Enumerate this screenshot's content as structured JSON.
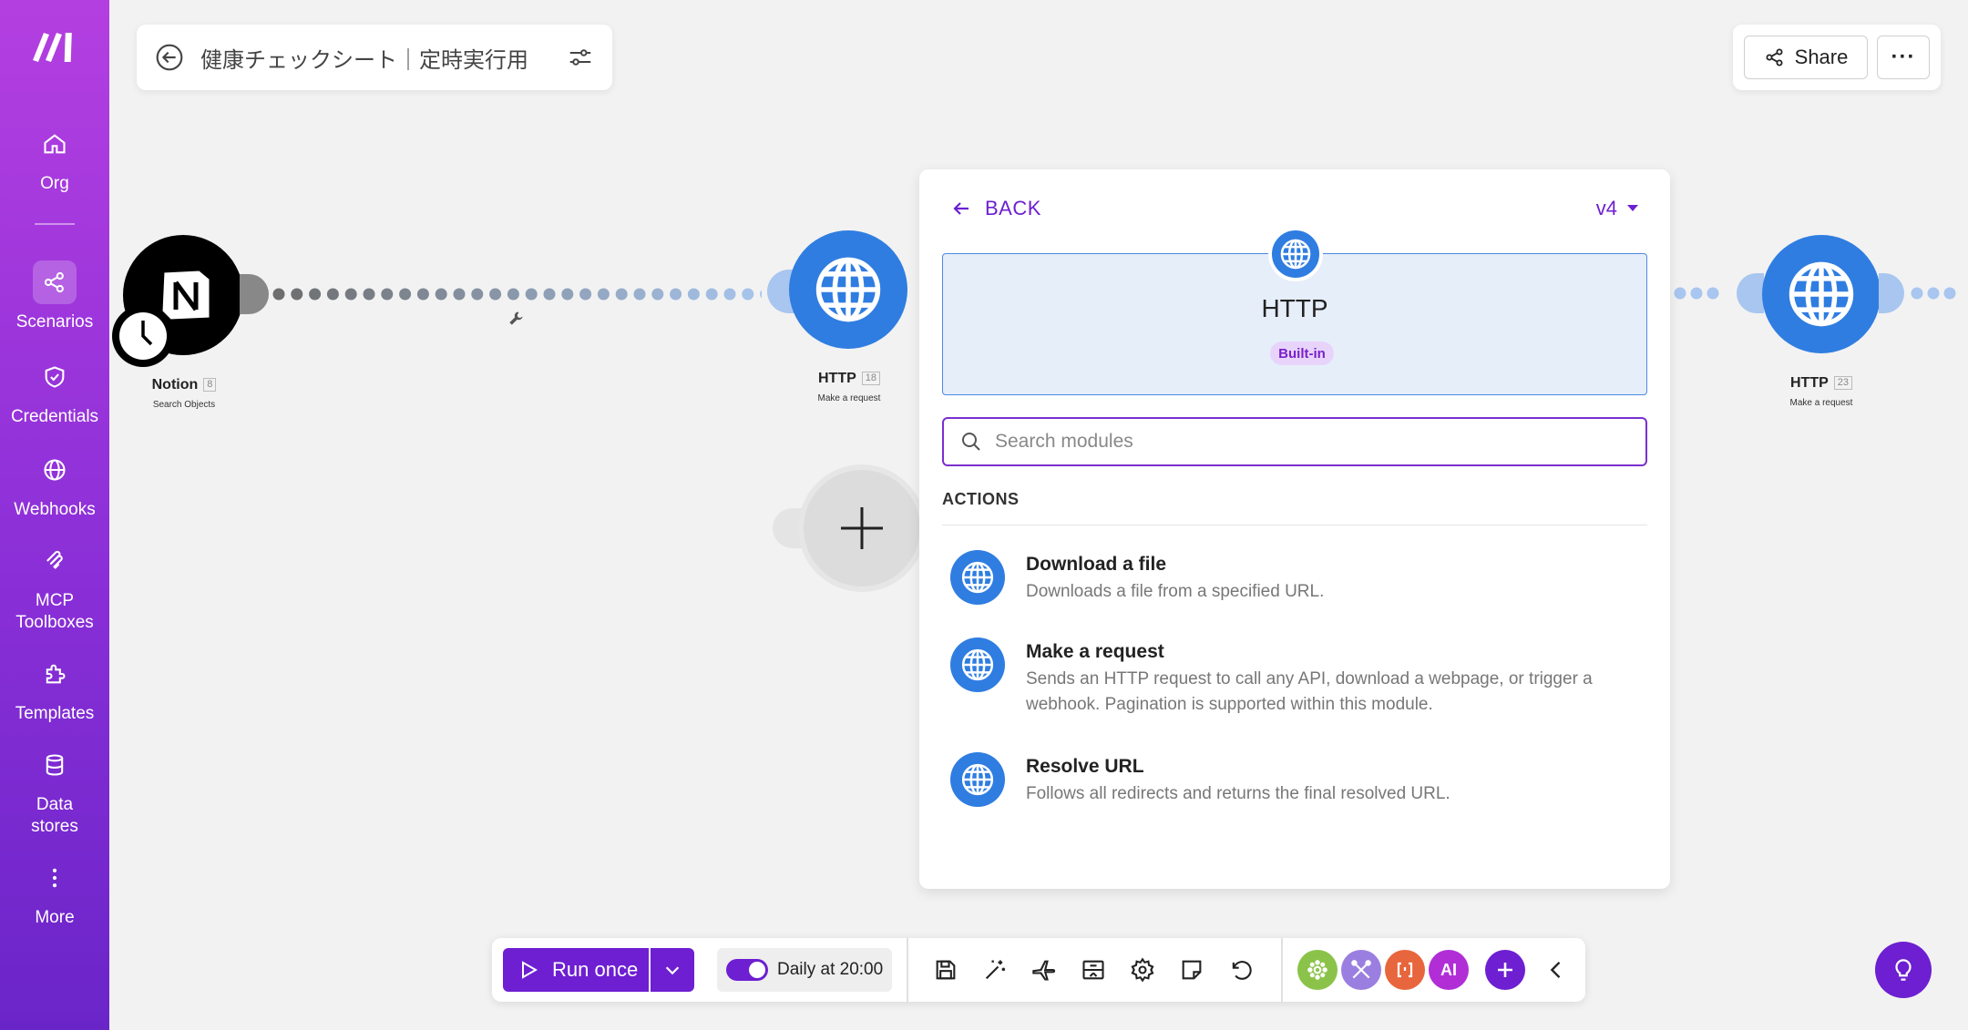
{
  "scenario": {
    "title": "健康チェックシート｜定時実行用"
  },
  "topbar": {
    "share_label": "Share",
    "more_label": "···"
  },
  "sidebar": {
    "items": [
      {
        "label": "Org",
        "icon": "home-icon"
      },
      {
        "label": "Scenarios",
        "icon": "share-nodes-icon",
        "active": true
      },
      {
        "label": "Credentials",
        "icon": "shield-check-icon"
      },
      {
        "label": "Webhooks",
        "icon": "globe-icon"
      },
      {
        "label": "MCP\nToolboxes",
        "label_line1": "MCP",
        "label_line2": "Toolboxes",
        "icon": "mcp-icon"
      },
      {
        "label": "Templates",
        "icon": "puzzle-icon"
      },
      {
        "label": "Data\nstores",
        "label_line1": "Data",
        "label_line2": "stores",
        "icon": "database-icon"
      },
      {
        "label": "More",
        "icon": "more-vertical-icon"
      }
    ]
  },
  "nodes": {
    "notion": {
      "name": "Notion",
      "badge": "8",
      "subtitle": "Search Objects"
    },
    "http1": {
      "name": "HTTP",
      "badge": "18",
      "subtitle": "Make a request"
    },
    "http2": {
      "name": "HTTP",
      "badge": "23",
      "subtitle": "Make a request"
    }
  },
  "panel": {
    "back_label": "BACK",
    "version": "v4",
    "module_name": "HTTP",
    "module_tag": "Built-in",
    "search_placeholder": "Search modules",
    "actions_heading": "ACTIONS",
    "actions": [
      {
        "title": "Download a file",
        "description": "Downloads a file from a specified URL."
      },
      {
        "title": "Make a request",
        "description": "Sends an HTTP request to call any API, download a webpage, or trigger a webhook. Pagination is supported within this module."
      },
      {
        "title": "Resolve URL",
        "description": "Follows all redirects and returns the final resolved URL."
      }
    ]
  },
  "toolbar": {
    "run_label": "Run once",
    "schedule_label": "Daily at 20:00",
    "schedule_enabled": true,
    "ai_label": "AI",
    "colors": {
      "accent": "#6d1fd1",
      "green": "#8bc34a",
      "lavender": "#9b7fe0",
      "orange": "#e8663d",
      "magenta": "#b12ed6"
    }
  }
}
